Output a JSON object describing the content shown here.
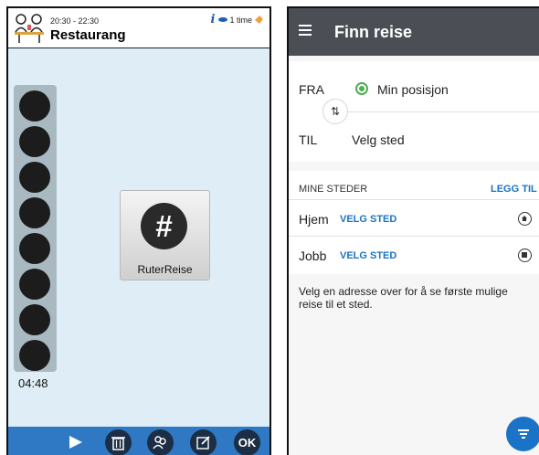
{
  "left_app": {
    "header": {
      "time_range": "20:30 - 22:30",
      "title": "Restaurang",
      "info_label": "1 time"
    },
    "dots_count": 8,
    "timer": "04:48",
    "app_tile": {
      "icon_glyph": "#",
      "label": "RuterReise"
    },
    "bottom_bar": {
      "ok_label": "OK"
    },
    "colors": {
      "background": "#dfeef6",
      "bottom_bar": "#2f78c4",
      "button": "#1c2e45"
    }
  },
  "right_app": {
    "appbar": {
      "title": "Finn reise"
    },
    "from": {
      "label": "FRA",
      "value": "Min posisjon"
    },
    "to": {
      "label": "TIL",
      "value": "Velg sted"
    },
    "swap_glyph": "⇅",
    "my_places": {
      "header": "MINE STEDER",
      "add_label": "LEGG TIL",
      "items": [
        {
          "name": "Hjem",
          "action": "VELG STED",
          "icon": "home-icon"
        },
        {
          "name": "Jobb",
          "action": "VELG STED",
          "icon": "briefcase-icon"
        }
      ]
    },
    "help_text": "Velg en adresse over for å se første mulige reise til et sted.",
    "colors": {
      "appbar": "#4b4f55",
      "accent": "#1a73c6",
      "location": "#4caf50"
    }
  }
}
